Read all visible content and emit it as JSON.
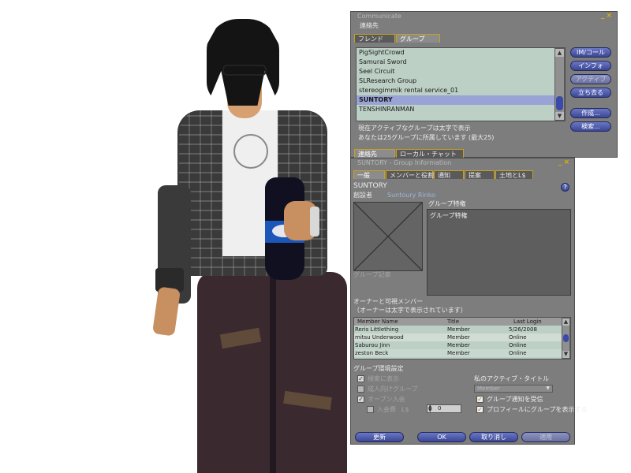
{
  "communicate": {
    "title": "Communicate",
    "subtitle": "連絡先",
    "tabs": [
      {
        "label": "フレンド"
      },
      {
        "label": "グループ"
      }
    ],
    "groups": [
      {
        "name": "PigSightCrowd"
      },
      {
        "name": "Samurai Sword"
      },
      {
        "name": "Seel Circuit"
      },
      {
        "name": "SLResearch Group"
      },
      {
        "name": "stereogimmik rental service_01"
      },
      {
        "name": "SUNTORY"
      },
      {
        "name": "TENSHINRANMAN"
      }
    ],
    "buttons": {
      "im_call": "IM/コール",
      "info": "インフォ",
      "activate": "アクティブ",
      "leave": "立ち去る",
      "create": "作成...",
      "search": "検索..."
    },
    "note_line1": "現在アクティブなグループは太字で表示",
    "note_line2": "あなたは25グループに所属しています (最大25)",
    "bottom_tabs": [
      {
        "label": "連絡先"
      },
      {
        "label": "ローカル・チャット"
      }
    ]
  },
  "group_info": {
    "title": "SUNTORY - Group Information",
    "tabs": [
      {
        "label": "一般"
      },
      {
        "label": "メンバーと役割"
      },
      {
        "label": "通知"
      },
      {
        "label": "提案"
      },
      {
        "label": "土地とL$"
      }
    ],
    "group_name": "SUNTORY",
    "founder_label": "創設者",
    "founder_name": "Suntoury Rinko",
    "help": "?",
    "insignia_label": "グループ記章",
    "charter_label": "グループ特権",
    "charter_text": "グループ特権",
    "members_heading_line1": "オーナーと可視メンバー",
    "members_heading_line2": "（オーナーは太字で表示されています）",
    "columns": [
      "Member Name",
      "Title",
      "Last Login"
    ],
    "members": [
      {
        "name": "Reris Littlething",
        "title": "Member",
        "last_login": "5/26/2008"
      },
      {
        "name": "mitsu Underwood",
        "title": "Member",
        "last_login": "Online"
      },
      {
        "name": "Saburou Jinn",
        "title": "Member",
        "last_login": "Online"
      },
      {
        "name": "zeston Beck",
        "title": "Member",
        "last_login": "Online"
      }
    ],
    "prefs_heading": "グループ環境設定",
    "prefs": {
      "show_in_search": "検索に表示",
      "open_enrollment": "オープン入会",
      "enrollment_fee": "入会費",
      "fee_currency": "L$",
      "mature": "成人向けグループ",
      "fee_value": "0"
    },
    "active_title_label": "私のアクティブ・タイトル",
    "active_title_value": "Member",
    "receive_notices": "グループ通知を受信",
    "list_in_profile": "プロフィールにグループを表示する",
    "footer": {
      "refresh": "更新",
      "ok": "OK",
      "cancel": "取り消し",
      "apply": "適用"
    }
  },
  "colors": {
    "panel": "#7d7d7d",
    "accent": "#c8a020",
    "button": "#3b4796",
    "list_bg": "#bdd0c6",
    "selection": "#9aa3d6"
  }
}
